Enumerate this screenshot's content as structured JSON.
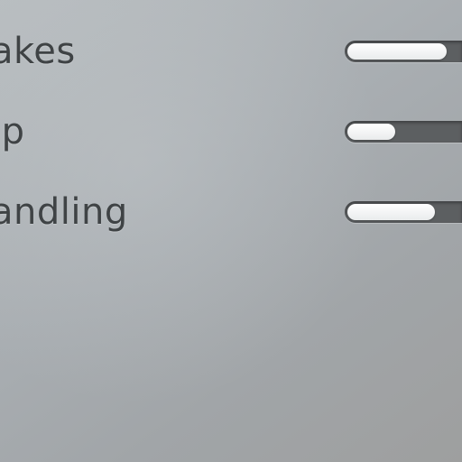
{
  "stats": [
    {
      "label": "akes",
      "value": 0.85
    },
    {
      "label": "ip",
      "value": 0.41
    },
    {
      "label": "andling",
      "value": 0.75
    }
  ]
}
